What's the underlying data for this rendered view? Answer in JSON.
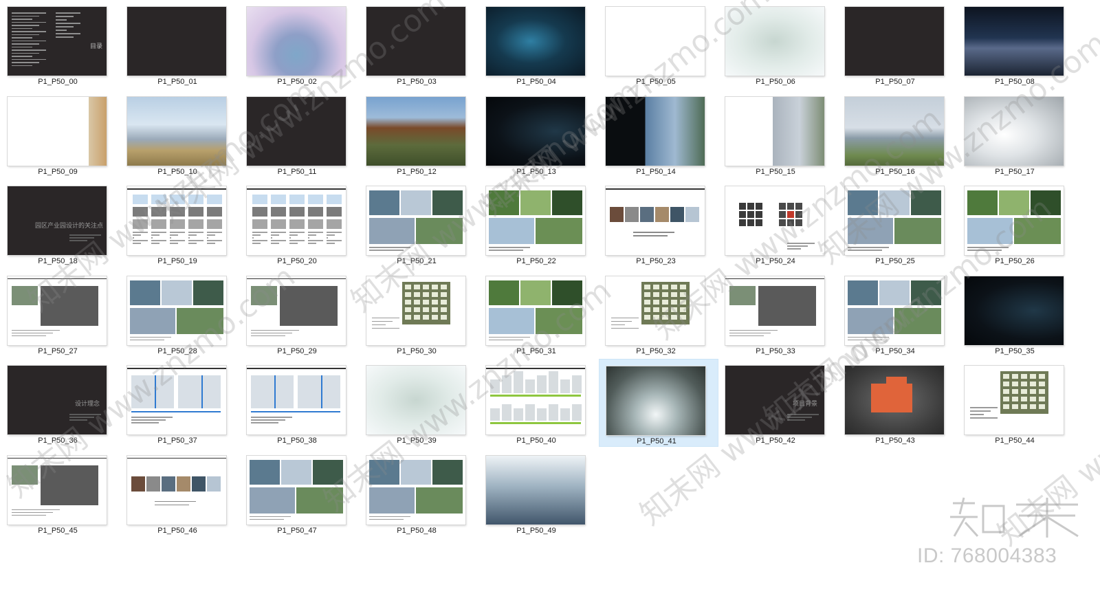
{
  "explorer": {
    "items": [
      {
        "name": "P1_P50_00",
        "kind": "doc-dark"
      },
      {
        "name": "P1_P50_01",
        "kind": "dark"
      },
      {
        "name": "P1_P50_02",
        "kind": "aerial-pink"
      },
      {
        "name": "P1_P50_03",
        "kind": "dark"
      },
      {
        "name": "P1_P50_04",
        "kind": "night"
      },
      {
        "name": "P1_P50_05",
        "kind": "white"
      },
      {
        "name": "P1_P50_06",
        "kind": "aerial-white"
      },
      {
        "name": "P1_P50_07",
        "kind": "dark"
      },
      {
        "name": "P1_P50_08",
        "kind": "night-city"
      },
      {
        "name": "P1_P50_09",
        "kind": "white-edge"
      },
      {
        "name": "P1_P50_10",
        "kind": "city-day"
      },
      {
        "name": "P1_P50_11",
        "kind": "dark"
      },
      {
        "name": "P1_P50_12",
        "kind": "court"
      },
      {
        "name": "P1_P50_13",
        "kind": "dark-models"
      },
      {
        "name": "P1_P50_14",
        "kind": "split"
      },
      {
        "name": "P1_P50_15",
        "kind": "white-bldg"
      },
      {
        "name": "P1_P50_16",
        "kind": "campus"
      },
      {
        "name": "P1_P50_17",
        "kind": "glow"
      },
      {
        "name": "P1_P50_18",
        "kind": "title-slide"
      },
      {
        "name": "P1_P50_19",
        "kind": "doc-light"
      },
      {
        "name": "P1_P50_20",
        "kind": "doc-light"
      },
      {
        "name": "P1_P50_21",
        "kind": "collage"
      },
      {
        "name": "P1_P50_22",
        "kind": "collage-green"
      },
      {
        "name": "P1_P50_23",
        "kind": "doc-strip"
      },
      {
        "name": "P1_P50_24",
        "kind": "doc-icons"
      },
      {
        "name": "P1_P50_25",
        "kind": "collage"
      },
      {
        "name": "P1_P50_26",
        "kind": "collage-green"
      },
      {
        "name": "P1_P50_27",
        "kind": "doc-photo"
      },
      {
        "name": "P1_P50_28",
        "kind": "collage"
      },
      {
        "name": "P1_P50_29",
        "kind": "doc-photo"
      },
      {
        "name": "P1_P50_30",
        "kind": "doc-plan"
      },
      {
        "name": "P1_P50_31",
        "kind": "collage-green"
      },
      {
        "name": "P1_P50_32",
        "kind": "doc-plan"
      },
      {
        "name": "P1_P50_33",
        "kind": "doc-photo"
      },
      {
        "name": "P1_P50_34",
        "kind": "collage"
      },
      {
        "name": "P1_P50_35",
        "kind": "dark-models"
      },
      {
        "name": "P1_P50_36",
        "kind": "title-slide"
      },
      {
        "name": "P1_P50_37",
        "kind": "doc-map"
      },
      {
        "name": "P1_P50_38",
        "kind": "doc-map"
      },
      {
        "name": "P1_P50_39",
        "kind": "aerial-white"
      },
      {
        "name": "P1_P50_40",
        "kind": "doc-section"
      },
      {
        "name": "P1_P50_41",
        "kind": "tunnel"
      },
      {
        "name": "P1_P50_42",
        "kind": "title-slide"
      },
      {
        "name": "P1_P50_43",
        "kind": "sat"
      },
      {
        "name": "P1_P50_44",
        "kind": "doc-plan"
      },
      {
        "name": "P1_P50_45",
        "kind": "doc-photo"
      },
      {
        "name": "P1_P50_46",
        "kind": "doc-strip"
      },
      {
        "name": "P1_P50_47",
        "kind": "collage"
      },
      {
        "name": "P1_P50_48",
        "kind": "collage"
      },
      {
        "name": "P1_P50_49",
        "kind": "atrium"
      }
    ],
    "selected_index": 41,
    "columns": 9
  },
  "slide_text": {
    "p00_title": "目录",
    "p18_title": "园区产业园设计的关注点",
    "p36_title": "设计理念",
    "p42_title": "项目背景"
  },
  "watermark": {
    "text": "知末网 www.znzmo.com",
    "brand": "知末",
    "id_label": "ID: 768004383"
  }
}
